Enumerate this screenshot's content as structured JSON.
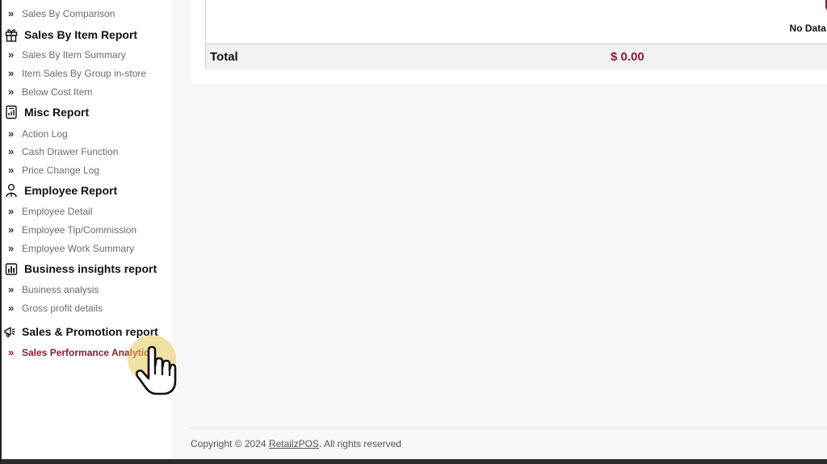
{
  "sidebar": {
    "top_item": "Sales By Comparison",
    "sections": [
      {
        "title": "Sales By Item Report",
        "icon": "gift-icon",
        "items": [
          "Sales By Item Summary",
          "Item Sales By Group in-store",
          "Below Cost Item"
        ]
      },
      {
        "title": "Misc Report",
        "icon": "receipt-icon",
        "items": [
          "Action Log",
          "Cash Drawer Function",
          "Price Change Log"
        ]
      },
      {
        "title": "Employee Report",
        "icon": "person-icon",
        "items": [
          "Employee Detail",
          "Employee Tip/Commission",
          "Employee Work Summary"
        ]
      },
      {
        "title": "Business insights report",
        "icon": "bar-chart-icon",
        "items": [
          "Business analysis",
          "Gross profit details"
        ]
      },
      {
        "title": "Sales & Promotion report",
        "icon": "megaphone-icon",
        "items": [
          "Sales Performance Analytics"
        ]
      }
    ],
    "active_item": "Sales Performance Analytics"
  },
  "main": {
    "no_data_text": "No Data Avail",
    "total_label": "Total",
    "total_value": "$ 0.00"
  },
  "footer": {
    "prefix": "Copyright © 2024 ",
    "link": "RetailzPOS",
    "suffix": ". All rights reserved"
  },
  "colors": {
    "accent": "#8b1c2e",
    "cursor_highlight": "#e8c85a"
  }
}
